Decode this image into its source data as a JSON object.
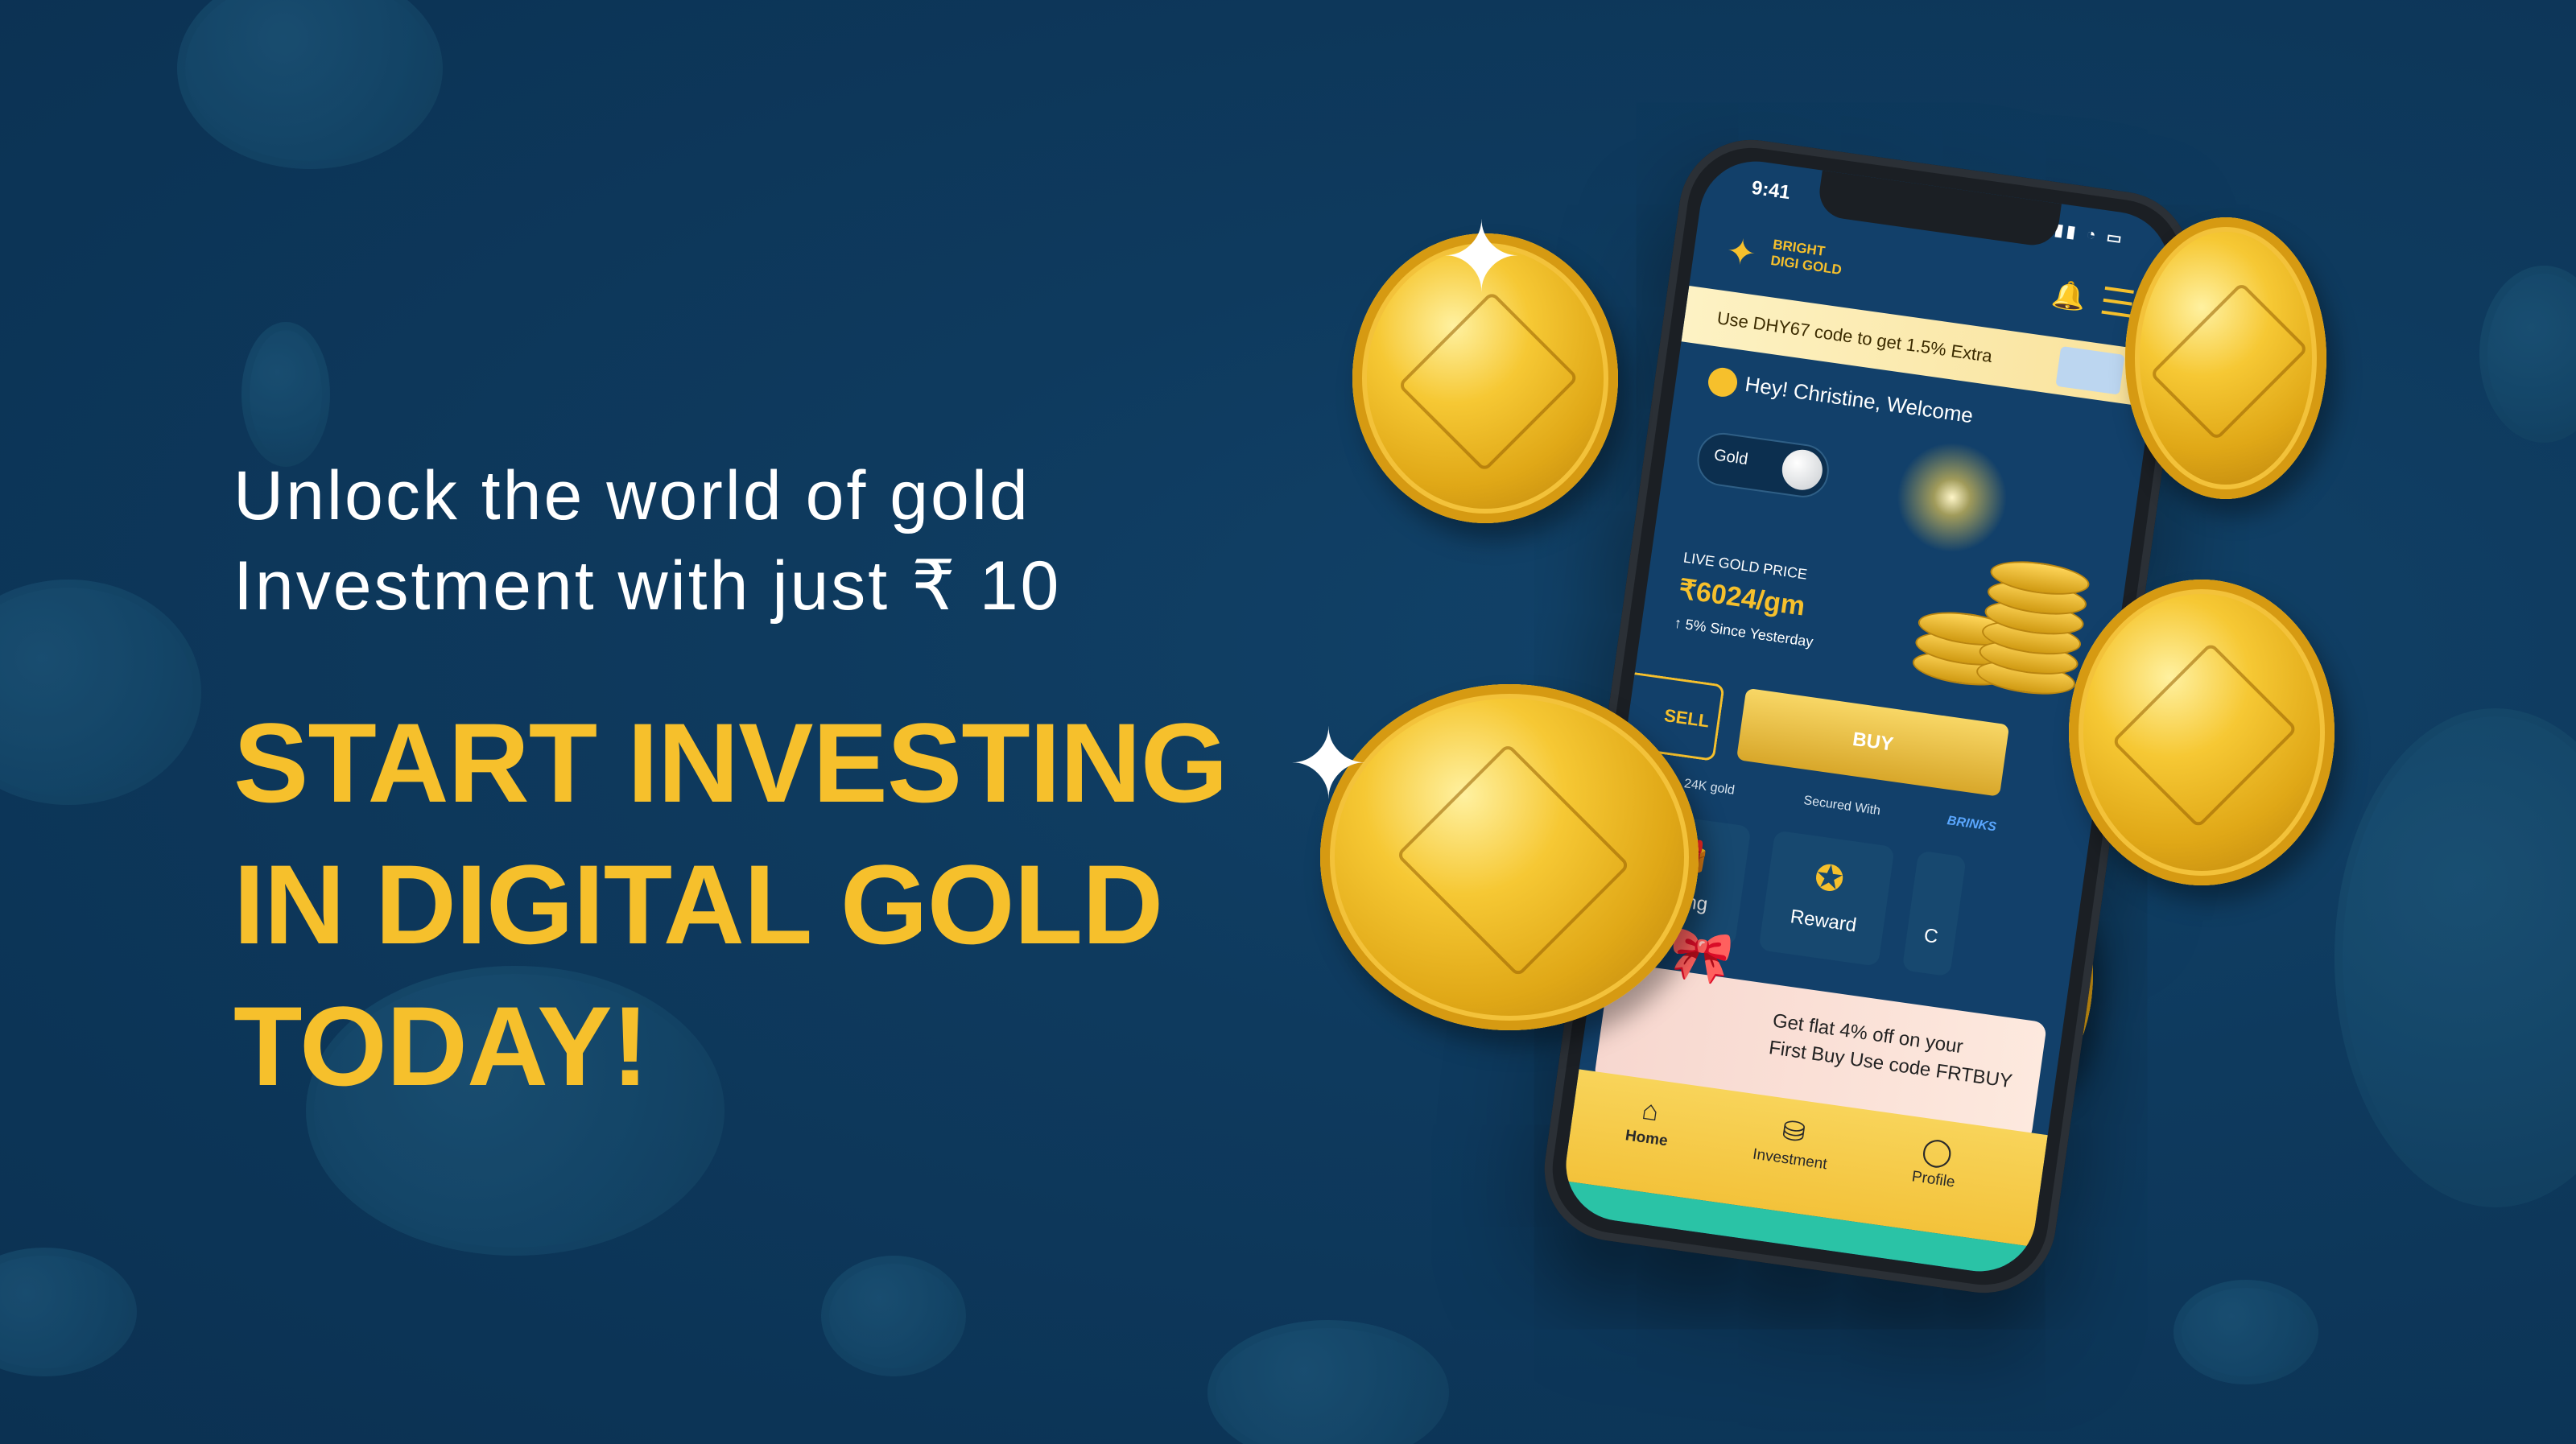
{
  "promo": {
    "subhead_line1": "Unlock the world of gold",
    "subhead_line2": "Investment with just ₹ 10",
    "headline_line1": "START INVESTING",
    "headline_line2": "IN DIGITAL GOLD",
    "headline_line3": "TODAY!"
  },
  "colors": {
    "background": "#0d3454",
    "accent_gold": "#f6c02c",
    "text_white": "#ffffff"
  },
  "phone": {
    "status_time": "9:41",
    "brand_line1": "BRIGHT",
    "brand_line2": "DIGI GOLD",
    "promo_strip": "Use DHY67 code to get 1.5% Extra",
    "welcome": "Hey! Christine, Welcome",
    "toggle_label": "Gold",
    "live_price_label": "LIVE GOLD PRICE",
    "live_price_value": "₹6024/gm",
    "price_change": "↑ 5% Since Yesterday",
    "sell_label": "SELL",
    "buy_label": "BUY",
    "purity_text": "24K gold",
    "secured_with": "Secured With",
    "secured_partner": "BRINKS",
    "tiles": [
      "Gifting",
      "Reward",
      "C"
    ],
    "offer_line1": "Get flat 4% off on your",
    "offer_line2": "First Buy Use code FRTBUY",
    "nav": [
      "Home",
      "Investment",
      "Profile"
    ]
  },
  "icons": [
    "gift-icon",
    "reward-badge-icon",
    "home-icon",
    "investment-icon",
    "profile-icon",
    "bell-icon",
    "menu-icon",
    "sparkle-icon"
  ]
}
